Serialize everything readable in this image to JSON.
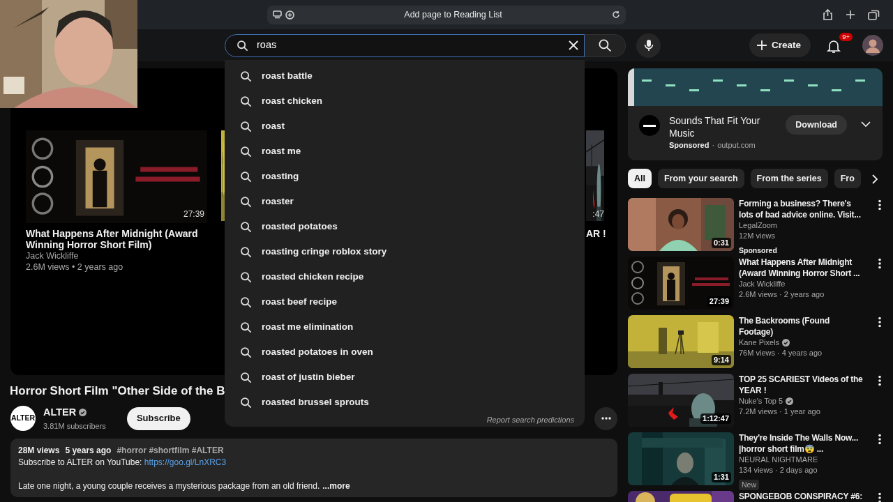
{
  "browser": {
    "address_text": "Add page to Reading List"
  },
  "masthead": {
    "search_value": "roas",
    "create_label": "Create",
    "notification_count": "9+"
  },
  "search_suggestions": [
    {
      "text": "roast battle"
    },
    {
      "text": "roast chicken"
    },
    {
      "text": "roast"
    },
    {
      "text": "roast me"
    },
    {
      "text": "roasting"
    },
    {
      "text": "roaster"
    },
    {
      "text": "roasted potatoes"
    },
    {
      "text": "roasting cringe roblox story"
    },
    {
      "text": "roasted chicken recipe"
    },
    {
      "text": "roast beef recipe"
    },
    {
      "text": "roast me elimination"
    },
    {
      "text": "roasted potatoes in oven"
    },
    {
      "text": "roast of justin bieber"
    },
    {
      "text": "roasted brussel sprouts"
    }
  ],
  "suggestions_footer": "Report search predictions",
  "end_screen": [
    {
      "title": "What Happens After Midnight (Award Winning Horror Short Film)",
      "channel": "Jack Wickliffe",
      "meta": "2.6M views • 2 years ago",
      "duration": "27:39"
    },
    {
      "kind": "picture"
    },
    {
      "title": "AR !",
      "duration": ":47"
    }
  ],
  "video": {
    "title": "Horror Short Film \"Other Side of the B",
    "channel_logo": "ALTER",
    "channel_name": "ALTER",
    "verified": true,
    "subscribers": "3.81M subscribers",
    "subscribe_label": "Subscribe",
    "description": {
      "views": "28M views",
      "date": "5 years ago",
      "hashtags": "#horror #shortfilm #ALTER",
      "subscribe_line": "Subscribe to ALTER on YouTube: ",
      "link": "https://goo.gl/LnXRC3",
      "summary": "Late one night, a young couple receives a mysterious package from an old friend.",
      "more": "...more"
    }
  },
  "ad": {
    "title": "Sounds That Fit Your Music",
    "sponsored": "Sponsored",
    "separator": "·",
    "domain": "output.com",
    "button": "Download"
  },
  "chips": [
    {
      "label": "All",
      "selected": true
    },
    {
      "label": "From your search",
      "selected": false
    },
    {
      "label": "From the series",
      "selected": false
    },
    {
      "label": "Fro",
      "selected": false
    }
  ],
  "related": [
    {
      "title": "Forming a business? There's lots of bad advice online. Visit...",
      "channel": "LegalZoom",
      "verified": false,
      "meta": "12M views",
      "duration": "0:31",
      "badge": {
        "text": "Sponsored",
        "kind": "sponsored"
      }
    },
    {
      "title": "What Happens After Midnight (Award Winning Horror Short ...",
      "channel": "Jack Wickliffe",
      "verified": false,
      "meta": "2.6M views · 2 years ago",
      "duration": "27:39"
    },
    {
      "title": "The Backrooms (Found Footage)",
      "channel": "Kane Pixels",
      "verified": true,
      "meta": "76M views · 4 years ago",
      "duration": "9:14"
    },
    {
      "title": "TOP 25 SCARIEST Videos of the YEAR !",
      "channel": "Nuke's Top 5",
      "verified": true,
      "meta": "7.2M views · 1 year ago",
      "duration": "1:12:47"
    },
    {
      "title": "They're Inside The Walls Now... |horror short film😨 ...",
      "channel": "NEURAL NIGHTMARE",
      "verified": false,
      "meta": "134 views · 2 days ago",
      "duration": "1:31",
      "badge": {
        "text": "New",
        "kind": "new"
      }
    },
    {
      "title": "SPONGEBOB CONSPIRACY #6:"
    }
  ]
}
